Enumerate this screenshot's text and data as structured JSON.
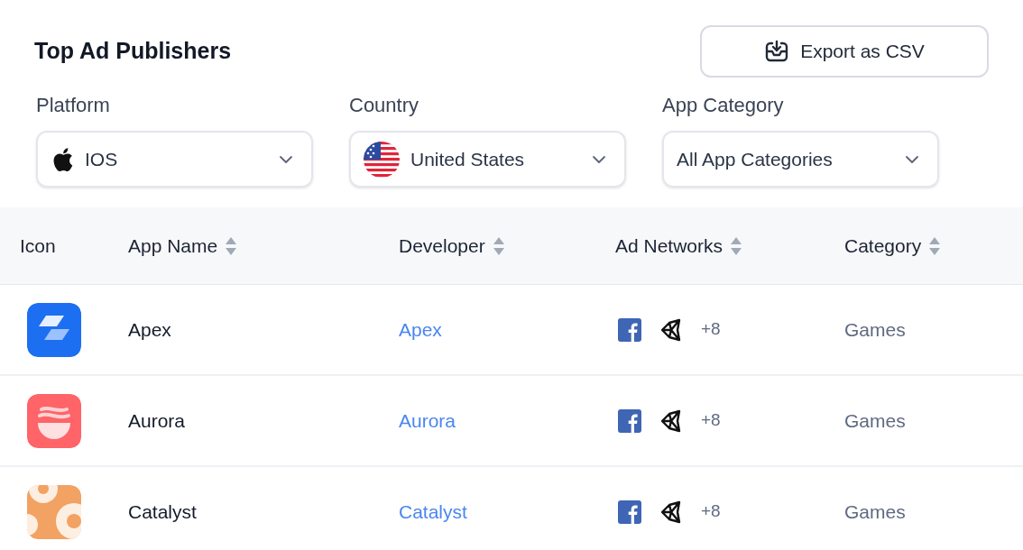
{
  "title": "Top Ad Publishers",
  "export_button": "Export as CSV",
  "filters": [
    {
      "label": "Platform",
      "value": "IOS",
      "kind": "apple"
    },
    {
      "label": "Country",
      "value": "United States",
      "kind": "flag"
    },
    {
      "label": "App Category",
      "value": "All App Categories",
      "kind": "plain"
    }
  ],
  "table": {
    "columns": [
      {
        "label": "Icon",
        "sortable": false
      },
      {
        "label": "App Name",
        "sortable": true
      },
      {
        "label": "Developer",
        "sortable": true
      },
      {
        "label": "Ad Networks",
        "sortable": true
      },
      {
        "label": "Category",
        "sortable": true
      }
    ],
    "rows": [
      {
        "kind": "layers",
        "app_name": "Apex",
        "developer": "Apex",
        "more_networks": "+8",
        "category": "Games"
      },
      {
        "kind": "waves",
        "app_name": "Aurora",
        "developer": "Aurora",
        "more_networks": "+8",
        "category": "Games"
      },
      {
        "kind": "rings",
        "app_name": "Catalyst",
        "developer": "Catalyst",
        "more_networks": "+8",
        "category": "Games"
      }
    ]
  }
}
